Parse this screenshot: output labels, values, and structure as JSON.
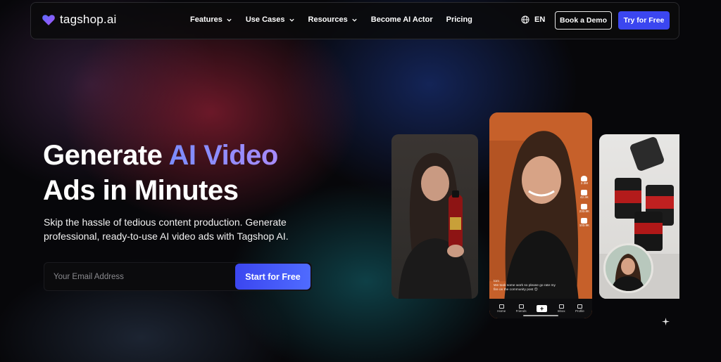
{
  "brand": {
    "name": "tagshop.ai",
    "logo_icon": "heart-logo-icon"
  },
  "nav": {
    "items": [
      {
        "label": "Features",
        "has_dropdown": true
      },
      {
        "label": "Use Cases",
        "has_dropdown": true
      },
      {
        "label": "Resources",
        "has_dropdown": true
      },
      {
        "label": "Become AI Actor",
        "has_dropdown": false
      },
      {
        "label": "Pricing",
        "has_dropdown": false
      }
    ],
    "language": "EN",
    "demo_label": "Book a Demo",
    "try_label": "Try for Free"
  },
  "hero": {
    "headline_part1": "Generate ",
    "headline_accent": "AI Video",
    "headline_part2": "Ads in Minutes",
    "subtitle": "Skip the hassle of tedious content production. Generate professional, ready-to-use AI video ads with Tagshop AI.",
    "email_placeholder": "Your Email Address",
    "cta_label": "Start for Free"
  },
  "phone": {
    "username": "tom",
    "caption": "We took some work so please go rate my fire on the community post 😊",
    "side_counts": [
      "2.3M",
      "42.3K",
      "233.8K",
      "103.9K"
    ],
    "tabs": [
      "Home",
      "Friends",
      "",
      "Inbox",
      "Profile"
    ]
  },
  "colors": {
    "accent_blue": "#3b46f0",
    "accent_gradient_start": "#7b8cff",
    "accent_gradient_end": "#a78bfa",
    "background": "#07070a"
  }
}
